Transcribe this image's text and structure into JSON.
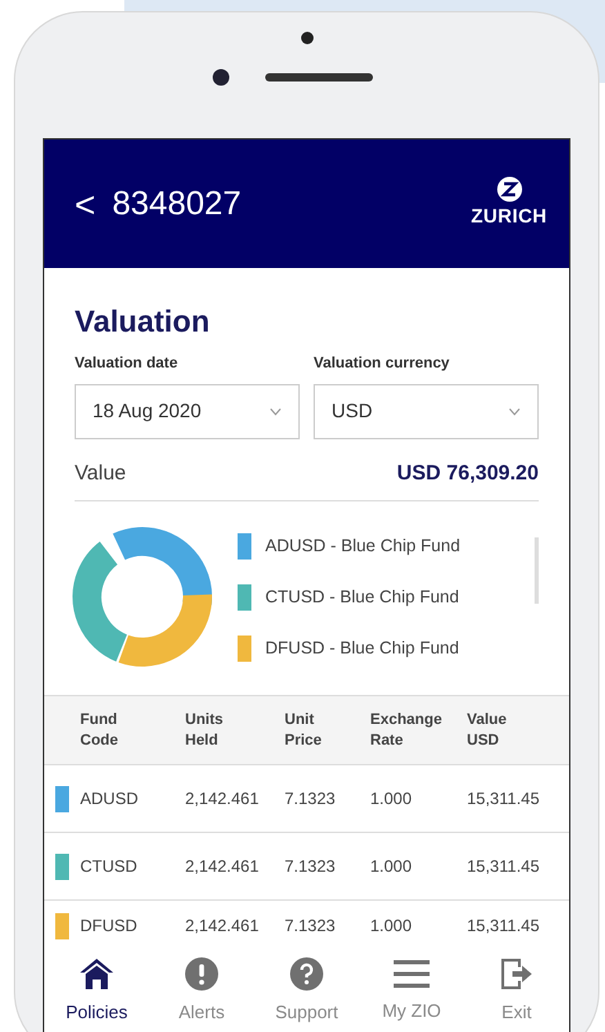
{
  "header": {
    "back": "<",
    "title": "8348027",
    "logo": "ZURICH"
  },
  "valuation": {
    "title": "Valuation",
    "date": {
      "label": "Valuation date",
      "value": "18 Aug 2020"
    },
    "currency": {
      "label": "Valuation currency",
      "value": "USD"
    },
    "value_label": "Value",
    "value": "USD 76,309.20"
  },
  "legend": [
    {
      "label": "ADUSD - Blue Chip Fund",
      "color": "#4aa8e0"
    },
    {
      "label": "CTUSD - Blue Chip Fund",
      "color": "#4fb8b3"
    },
    {
      "label": "DFUSD - Blue Chip Fund",
      "color": "#f0b83e"
    }
  ],
  "table": {
    "columns": [
      "Fund\nCode",
      "Units\nHeld",
      "Unit\nPrice",
      "Exchange\nRate",
      "Value\nUSD"
    ],
    "rows": [
      {
        "color": "#4aa8e0",
        "cells": [
          "ADUSD",
          "2,142.461",
          "7.1323",
          "1.000",
          "15,311.45"
        ]
      },
      {
        "color": "#4fb8b3",
        "cells": [
          "CTUSD",
          "2,142.461",
          "7.1323",
          "1.000",
          "15,311.45"
        ]
      },
      {
        "color": "#f0b83e",
        "cells": [
          "DFUSD",
          "2,142.461",
          "7.1323",
          "1.000",
          "15,311.45"
        ]
      }
    ]
  },
  "nav": [
    {
      "kind": "home",
      "label": "Policies",
      "selected": true
    },
    {
      "kind": "alert",
      "label": "Alerts",
      "selected": false
    },
    {
      "kind": "help",
      "label": "Support",
      "selected": false
    },
    {
      "kind": "menu",
      "label": "My ZIO",
      "selected": false
    },
    {
      "kind": "exit",
      "label": "Exit",
      "selected": false
    }
  ]
}
